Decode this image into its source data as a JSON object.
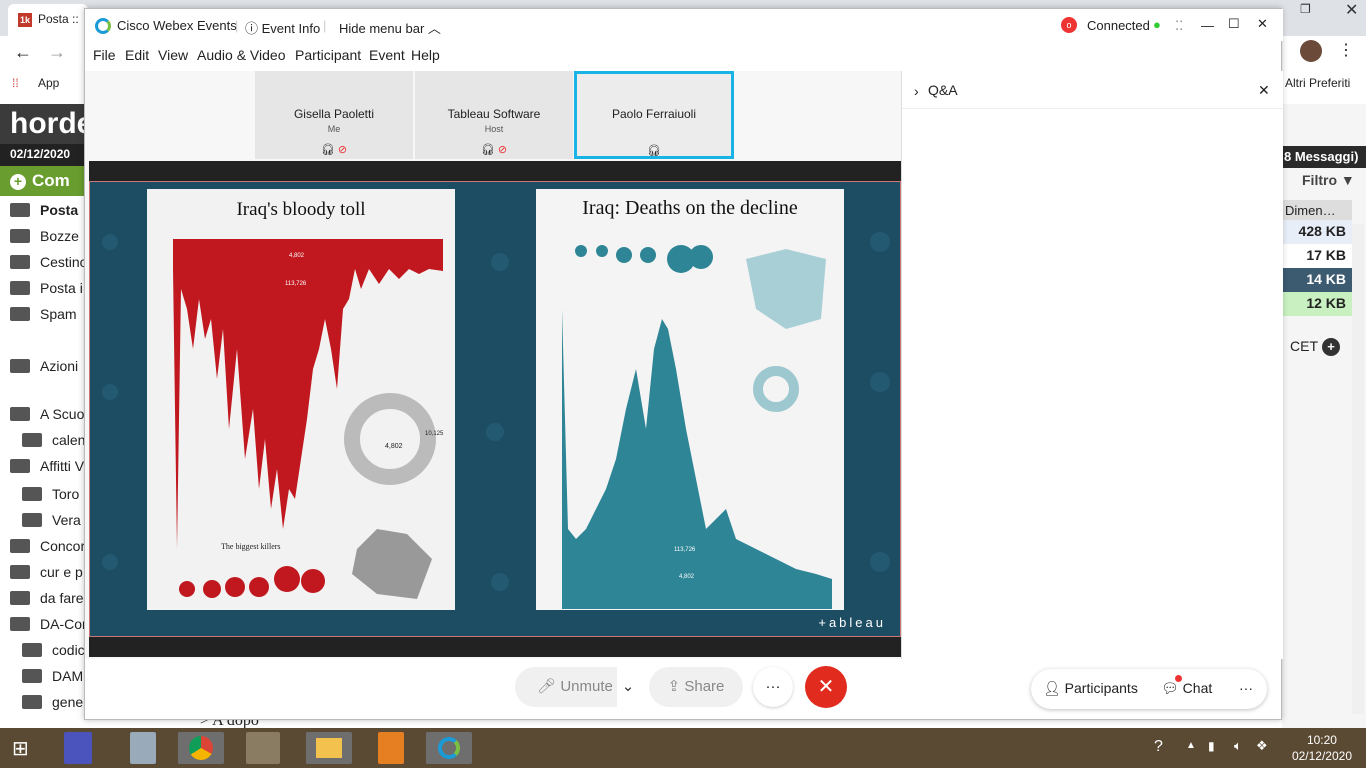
{
  "browser": {
    "tab_title": "Posta ::",
    "bookmarks": [
      "App",
      "Altri Preferiti"
    ]
  },
  "horde": {
    "logo": "horde",
    "date": "02/12/2020",
    "compose": "Com",
    "messages_count": "8 Messaggi)",
    "filter": "Filtro",
    "folders": [
      "Posta",
      "Bozze",
      "Cestino",
      "Posta i",
      "Spam",
      "Azioni",
      "A Scuo",
      "calen",
      "Affitti V",
      "Toro",
      "Vera",
      "Concor",
      "cur e p",
      "da fare",
      "DA-Con",
      "codic",
      "DAM",
      "gener"
    ],
    "size_col": "Dimen…",
    "sizes": [
      "428 KB",
      "17 KB",
      "14 KB",
      "12 KB"
    ],
    "cet": "CET",
    "message_line": "> A dopo"
  },
  "webex": {
    "title": "Cisco Webex Events",
    "event_info": "Event Info",
    "hide_menu": "Hide menu bar",
    "status": "Connected",
    "menu": [
      "File",
      "Edit",
      "View",
      "Audio & Video",
      "Participant",
      "Event",
      "Help"
    ],
    "participants": [
      {
        "name": "Gisella Paoletti",
        "role": "Me"
      },
      {
        "name": "Tableau Software",
        "role": "Host"
      },
      {
        "name": "Paolo Ferraiuoli",
        "role": ""
      }
    ],
    "share": {
      "poster1_title": "Iraq's bloody toll",
      "poster2_title": "Iraq: Deaths on the decline",
      "brand": "+ableau",
      "p1_sub": "The biggest killers",
      "p1_n1": "4,802",
      "p1_n2": "113,726",
      "p1_n3": "4,802",
      "p1_n4": "10,125",
      "p2_n1": "113,726",
      "p2_n2": "4,802"
    },
    "controls": {
      "unmute": "Unmute",
      "share": "Share",
      "more": "···",
      "leave": "✕"
    },
    "qa": {
      "title": "Q&A"
    },
    "panel_buttons": {
      "participants": "Participants",
      "chat": "Chat",
      "more": "···"
    }
  },
  "taskbar": {
    "time": "10:20",
    "date": "02/12/2020"
  }
}
